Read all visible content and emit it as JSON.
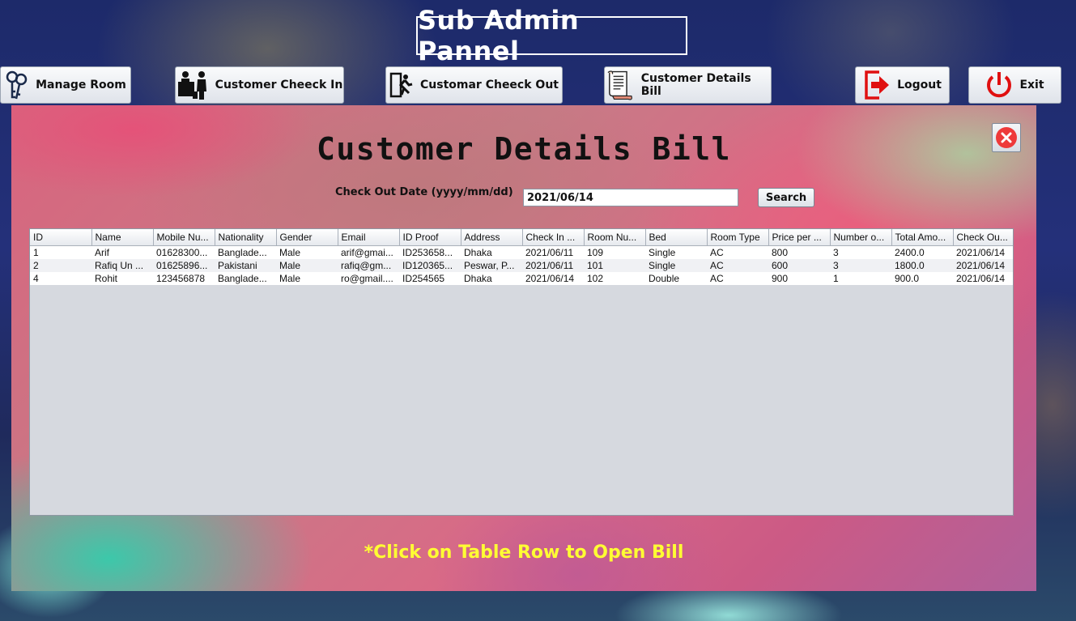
{
  "app_title": "Sub Admin Pannel",
  "nav": {
    "manage_room": "Manage Room",
    "check_in": "Customer Cheeck In",
    "check_out": "Customar Cheeck Out",
    "details_bill": "Customer Details Bill",
    "logout": "Logout",
    "exit": "Exit"
  },
  "panel": {
    "heading": "Customer Details Bill",
    "date_label": "Check Out Date (yyyy/mm/dd)",
    "date_value": "2021/06/14",
    "search_label": "Search",
    "footer_note": "*Click on Table Row to Open Bill"
  },
  "table": {
    "columns": [
      "ID",
      "Name",
      "Mobile Nu...",
      "Nationality",
      "Gender",
      "Email",
      "ID Proof",
      "Address",
      "Check In ...",
      "Room Nu...",
      "Bed",
      "Room Type",
      "Price per ...",
      "Number o...",
      "Total Amo...",
      "Check Ou..."
    ],
    "rows": [
      [
        "1",
        "Arif",
        "01628300...",
        "Banglade...",
        "Male",
        "arif@gmai...",
        "ID253658...",
        "Dhaka",
        "2021/06/11",
        "109",
        "Single",
        "AC",
        "800",
        "3",
        "2400.0",
        "2021/06/14"
      ],
      [
        "2",
        "Rafiq Un ...",
        "01625896...",
        "Pakistani",
        "Male",
        "rafiq@gm...",
        "ID120365...",
        "Peswar, P...",
        "2021/06/11",
        "101",
        "Single",
        "AC",
        "600",
        "3",
        "1800.0",
        "2021/06/14"
      ],
      [
        "4",
        "Rohit",
        "123456878",
        "Banglade...",
        "Male",
        "ro@gmail....",
        "ID254565",
        "Dhaka",
        "2021/06/14",
        "102",
        "Double",
        "AC",
        "900",
        "1",
        "900.0",
        "2021/06/14"
      ]
    ]
  },
  "colors": {
    "accent_red": "#e02020",
    "footer_text": "#ffff33"
  }
}
